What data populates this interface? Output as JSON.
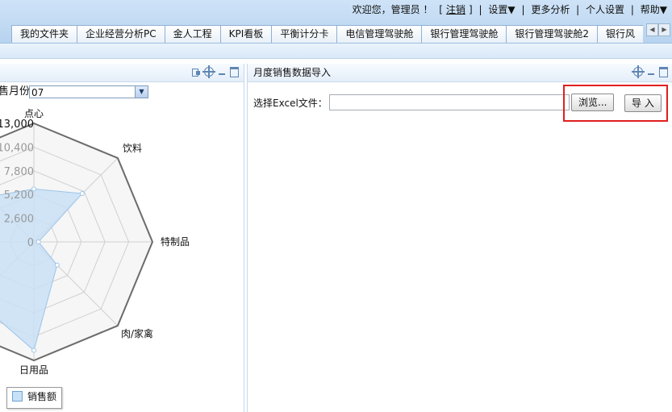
{
  "user_bar": {
    "welcome": "欢迎您，管理员 ！",
    "logout": "注销",
    "settings": "设置▼",
    "more_analysis": "更多分析",
    "personal_settings": "个人设置",
    "help": "帮助▼"
  },
  "tabs": [
    "我的文件夹",
    "企业经营分析PC",
    "金人工程",
    "KPI看板",
    "平衡计分卡",
    "电信管理驾驶舱",
    "银行管理驾驶舱",
    "银行管理驾驶舱2",
    "银行风"
  ],
  "left_panel": {
    "month_label": "售月份",
    "month_value": "07"
  },
  "right_panel": {
    "title": "月度销售数据导入",
    "file_label": "选择Excel文件：",
    "file_value": "",
    "browse_label": "浏览...",
    "import_label": "导 入"
  },
  "chart_data": {
    "type": "radar",
    "categories": [
      "点心",
      "饮料",
      "特制品",
      "肉/家禽",
      "日用品"
    ],
    "axis_ticks": [
      "13,000",
      "10,400",
      "7,800",
      "5,200",
      "2,600",
      "0"
    ],
    "ylim": [
      0,
      13000
    ],
    "series": [
      {
        "name": "销售额",
        "values": [
          5800,
          7500,
          500,
          3600,
          11900
        ]
      }
    ],
    "colors": {
      "fill": "#c9e1f6",
      "stroke": "#9cc4e8",
      "outline": "#6b6b6b"
    },
    "legend": "bottom-left"
  }
}
